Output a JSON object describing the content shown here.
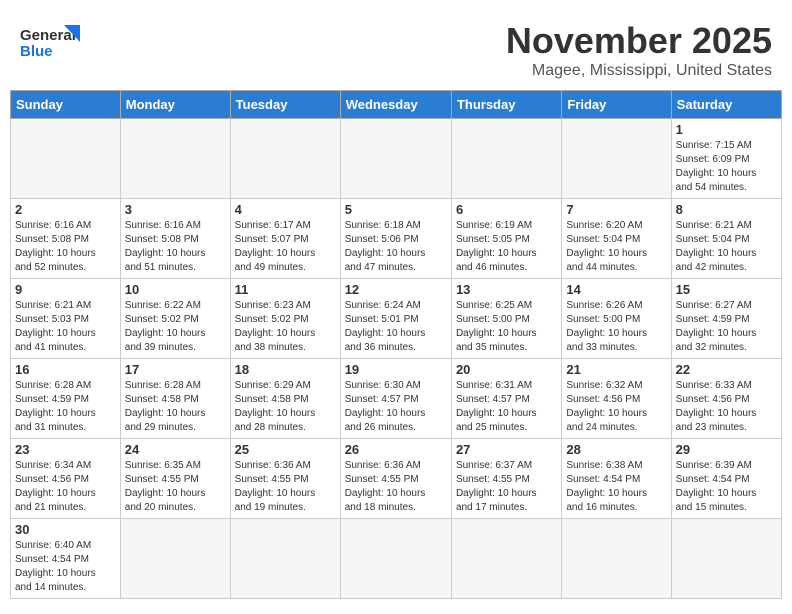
{
  "header": {
    "logo_text_general": "General",
    "logo_text_blue": "Blue",
    "month": "November 2025",
    "location": "Magee, Mississippi, United States"
  },
  "days_of_week": [
    "Sunday",
    "Monday",
    "Tuesday",
    "Wednesday",
    "Thursday",
    "Friday",
    "Saturday"
  ],
  "weeks": [
    [
      {
        "day": "",
        "info": ""
      },
      {
        "day": "",
        "info": ""
      },
      {
        "day": "",
        "info": ""
      },
      {
        "day": "",
        "info": ""
      },
      {
        "day": "",
        "info": ""
      },
      {
        "day": "",
        "info": ""
      },
      {
        "day": "1",
        "info": "Sunrise: 7:15 AM\nSunset: 6:09 PM\nDaylight: 10 hours\nand 54 minutes."
      }
    ],
    [
      {
        "day": "2",
        "info": "Sunrise: 6:16 AM\nSunset: 5:08 PM\nDaylight: 10 hours\nand 52 minutes."
      },
      {
        "day": "3",
        "info": "Sunrise: 6:16 AM\nSunset: 5:08 PM\nDaylight: 10 hours\nand 51 minutes."
      },
      {
        "day": "4",
        "info": "Sunrise: 6:17 AM\nSunset: 5:07 PM\nDaylight: 10 hours\nand 49 minutes."
      },
      {
        "day": "5",
        "info": "Sunrise: 6:18 AM\nSunset: 5:06 PM\nDaylight: 10 hours\nand 47 minutes."
      },
      {
        "day": "6",
        "info": "Sunrise: 6:19 AM\nSunset: 5:05 PM\nDaylight: 10 hours\nand 46 minutes."
      },
      {
        "day": "7",
        "info": "Sunrise: 6:20 AM\nSunset: 5:04 PM\nDaylight: 10 hours\nand 44 minutes."
      },
      {
        "day": "8",
        "info": "Sunrise: 6:21 AM\nSunset: 5:04 PM\nDaylight: 10 hours\nand 42 minutes."
      }
    ],
    [
      {
        "day": "9",
        "info": "Sunrise: 6:21 AM\nSunset: 5:03 PM\nDaylight: 10 hours\nand 41 minutes."
      },
      {
        "day": "10",
        "info": "Sunrise: 6:22 AM\nSunset: 5:02 PM\nDaylight: 10 hours\nand 39 minutes."
      },
      {
        "day": "11",
        "info": "Sunrise: 6:23 AM\nSunset: 5:02 PM\nDaylight: 10 hours\nand 38 minutes."
      },
      {
        "day": "12",
        "info": "Sunrise: 6:24 AM\nSunset: 5:01 PM\nDaylight: 10 hours\nand 36 minutes."
      },
      {
        "day": "13",
        "info": "Sunrise: 6:25 AM\nSunset: 5:00 PM\nDaylight: 10 hours\nand 35 minutes."
      },
      {
        "day": "14",
        "info": "Sunrise: 6:26 AM\nSunset: 5:00 PM\nDaylight: 10 hours\nand 33 minutes."
      },
      {
        "day": "15",
        "info": "Sunrise: 6:27 AM\nSunset: 4:59 PM\nDaylight: 10 hours\nand 32 minutes."
      }
    ],
    [
      {
        "day": "16",
        "info": "Sunrise: 6:28 AM\nSunset: 4:59 PM\nDaylight: 10 hours\nand 31 minutes."
      },
      {
        "day": "17",
        "info": "Sunrise: 6:28 AM\nSunset: 4:58 PM\nDaylight: 10 hours\nand 29 minutes."
      },
      {
        "day": "18",
        "info": "Sunrise: 6:29 AM\nSunset: 4:58 PM\nDaylight: 10 hours\nand 28 minutes."
      },
      {
        "day": "19",
        "info": "Sunrise: 6:30 AM\nSunset: 4:57 PM\nDaylight: 10 hours\nand 26 minutes."
      },
      {
        "day": "20",
        "info": "Sunrise: 6:31 AM\nSunset: 4:57 PM\nDaylight: 10 hours\nand 25 minutes."
      },
      {
        "day": "21",
        "info": "Sunrise: 6:32 AM\nSunset: 4:56 PM\nDaylight: 10 hours\nand 24 minutes."
      },
      {
        "day": "22",
        "info": "Sunrise: 6:33 AM\nSunset: 4:56 PM\nDaylight: 10 hours\nand 23 minutes."
      }
    ],
    [
      {
        "day": "23",
        "info": "Sunrise: 6:34 AM\nSunset: 4:56 PM\nDaylight: 10 hours\nand 21 minutes."
      },
      {
        "day": "24",
        "info": "Sunrise: 6:35 AM\nSunset: 4:55 PM\nDaylight: 10 hours\nand 20 minutes."
      },
      {
        "day": "25",
        "info": "Sunrise: 6:36 AM\nSunset: 4:55 PM\nDaylight: 10 hours\nand 19 minutes."
      },
      {
        "day": "26",
        "info": "Sunrise: 6:36 AM\nSunset: 4:55 PM\nDaylight: 10 hours\nand 18 minutes."
      },
      {
        "day": "27",
        "info": "Sunrise: 6:37 AM\nSunset: 4:55 PM\nDaylight: 10 hours\nand 17 minutes."
      },
      {
        "day": "28",
        "info": "Sunrise: 6:38 AM\nSunset: 4:54 PM\nDaylight: 10 hours\nand 16 minutes."
      },
      {
        "day": "29",
        "info": "Sunrise: 6:39 AM\nSunset: 4:54 PM\nDaylight: 10 hours\nand 15 minutes."
      }
    ],
    [
      {
        "day": "30",
        "info": "Sunrise: 6:40 AM\nSunset: 4:54 PM\nDaylight: 10 hours\nand 14 minutes."
      },
      {
        "day": "",
        "info": ""
      },
      {
        "day": "",
        "info": ""
      },
      {
        "day": "",
        "info": ""
      },
      {
        "day": "",
        "info": ""
      },
      {
        "day": "",
        "info": ""
      },
      {
        "day": "",
        "info": ""
      }
    ]
  ]
}
